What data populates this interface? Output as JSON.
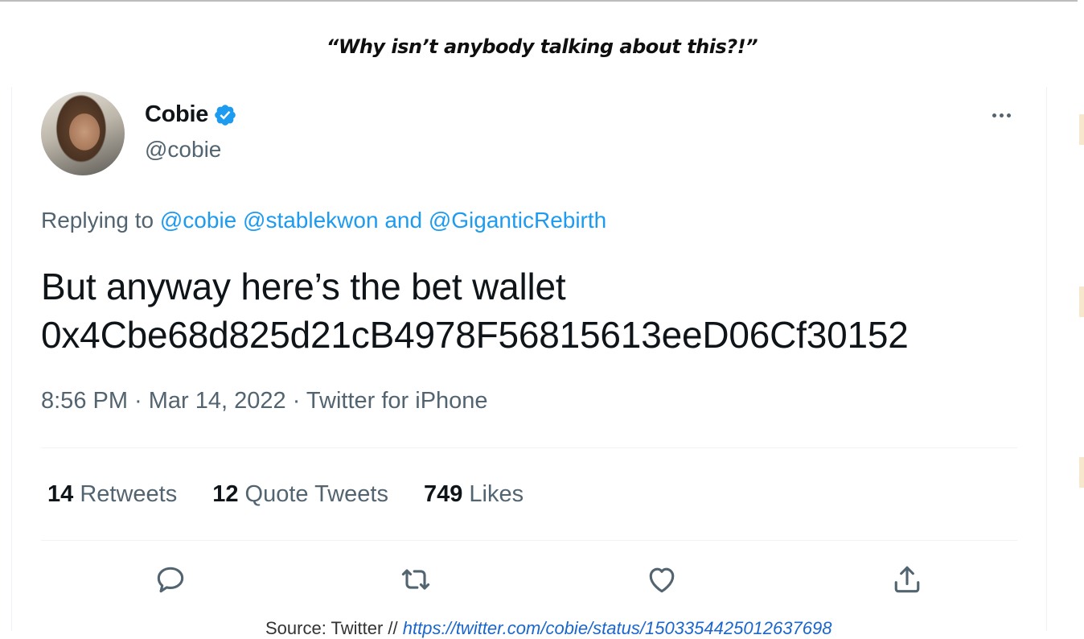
{
  "caption": "“Why isn’t anybody talking about this?!”",
  "tweet": {
    "author_name": "Cobie",
    "author_handle": "@cobie",
    "verified_icon": "verified-badge-icon",
    "replying_prefix": "Replying to",
    "replying_mentions": [
      "@cobie",
      "@stablekwon",
      "and",
      "@GiganticRebirth"
    ],
    "text_line1": "But anyway here’s the bet wallet",
    "text_line2": "0x4Cbe68d825d21cB4978F56815613eeD06Cf30152",
    "timestamp": "8:56 PM · Mar 14, 2022 · Twitter for iPhone",
    "stats": [
      {
        "count": "14",
        "label": "Retweets"
      },
      {
        "count": "12",
        "label": "Quote Tweets"
      },
      {
        "count": "749",
        "label": "Likes"
      }
    ],
    "actions": [
      "reply-icon",
      "retweet-icon",
      "like-icon",
      "share-icon"
    ]
  },
  "source": {
    "prefix": "Source: Twitter //",
    "link": "https://twitter.com/cobie/status/1503354425012637698"
  },
  "colors": {
    "link_blue": "#1d9bf0",
    "muted_text": "#536471",
    "main_text": "#0f1419",
    "divider": "#eff3f4"
  }
}
